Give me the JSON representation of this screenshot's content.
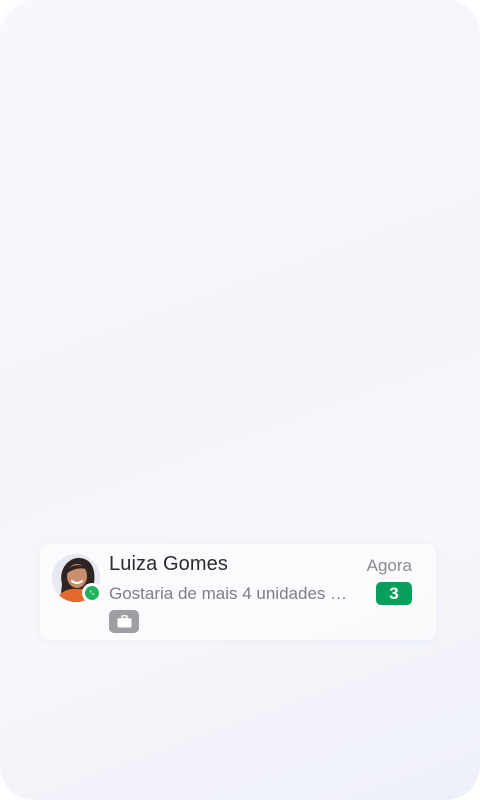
{
  "conversation": {
    "contact_name": "Luiza Gomes",
    "timestamp": "Agora",
    "message_preview": "Gostaria de mais 4 unidades do produto",
    "unread_count": "3",
    "channel_icon": "whatsapp-icon",
    "tag_icon": "briefcase-icon"
  },
  "colors": {
    "unread_badge": "#05a05b",
    "whatsapp": "#22b35e",
    "tag_chip": "#9e9ea5",
    "name_text": "#2a2a33",
    "secondary_text": "#7d7d86"
  }
}
